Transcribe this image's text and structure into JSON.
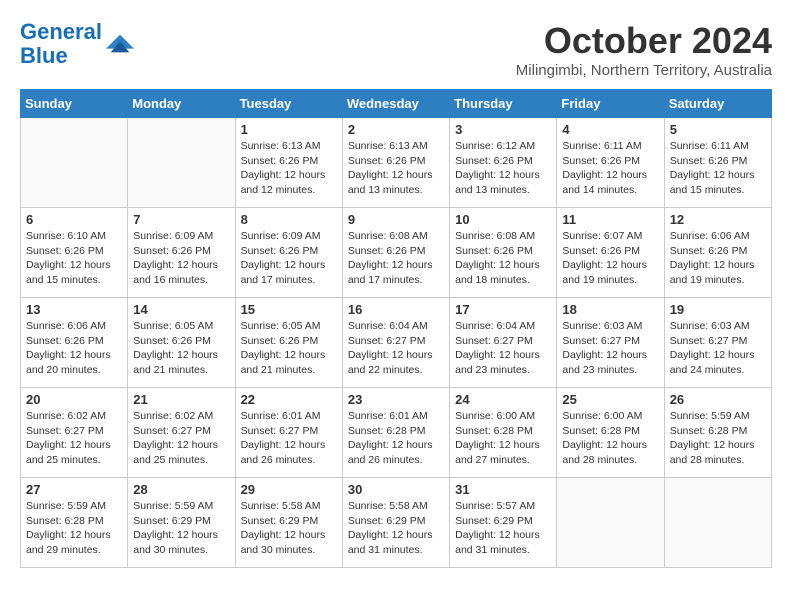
{
  "header": {
    "logo_line1": "General",
    "logo_line2": "Blue",
    "month_year": "October 2024",
    "location": "Milingimbi, Northern Territory, Australia"
  },
  "days_of_week": [
    "Sunday",
    "Monday",
    "Tuesday",
    "Wednesday",
    "Thursday",
    "Friday",
    "Saturday"
  ],
  "weeks": [
    [
      {
        "day": "",
        "sunrise": "",
        "sunset": "",
        "daylight": ""
      },
      {
        "day": "",
        "sunrise": "",
        "sunset": "",
        "daylight": ""
      },
      {
        "day": "1",
        "sunrise": "Sunrise: 6:13 AM",
        "sunset": "Sunset: 6:26 PM",
        "daylight": "Daylight: 12 hours and 12 minutes."
      },
      {
        "day": "2",
        "sunrise": "Sunrise: 6:13 AM",
        "sunset": "Sunset: 6:26 PM",
        "daylight": "Daylight: 12 hours and 13 minutes."
      },
      {
        "day": "3",
        "sunrise": "Sunrise: 6:12 AM",
        "sunset": "Sunset: 6:26 PM",
        "daylight": "Daylight: 12 hours and 13 minutes."
      },
      {
        "day": "4",
        "sunrise": "Sunrise: 6:11 AM",
        "sunset": "Sunset: 6:26 PM",
        "daylight": "Daylight: 12 hours and 14 minutes."
      },
      {
        "day": "5",
        "sunrise": "Sunrise: 6:11 AM",
        "sunset": "Sunset: 6:26 PM",
        "daylight": "Daylight: 12 hours and 15 minutes."
      }
    ],
    [
      {
        "day": "6",
        "sunrise": "Sunrise: 6:10 AM",
        "sunset": "Sunset: 6:26 PM",
        "daylight": "Daylight: 12 hours and 15 minutes."
      },
      {
        "day": "7",
        "sunrise": "Sunrise: 6:09 AM",
        "sunset": "Sunset: 6:26 PM",
        "daylight": "Daylight: 12 hours and 16 minutes."
      },
      {
        "day": "8",
        "sunrise": "Sunrise: 6:09 AM",
        "sunset": "Sunset: 6:26 PM",
        "daylight": "Daylight: 12 hours and 17 minutes."
      },
      {
        "day": "9",
        "sunrise": "Sunrise: 6:08 AM",
        "sunset": "Sunset: 6:26 PM",
        "daylight": "Daylight: 12 hours and 17 minutes."
      },
      {
        "day": "10",
        "sunrise": "Sunrise: 6:08 AM",
        "sunset": "Sunset: 6:26 PM",
        "daylight": "Daylight: 12 hours and 18 minutes."
      },
      {
        "day": "11",
        "sunrise": "Sunrise: 6:07 AM",
        "sunset": "Sunset: 6:26 PM",
        "daylight": "Daylight: 12 hours and 19 minutes."
      },
      {
        "day": "12",
        "sunrise": "Sunrise: 6:06 AM",
        "sunset": "Sunset: 6:26 PM",
        "daylight": "Daylight: 12 hours and 19 minutes."
      }
    ],
    [
      {
        "day": "13",
        "sunrise": "Sunrise: 6:06 AM",
        "sunset": "Sunset: 6:26 PM",
        "daylight": "Daylight: 12 hours and 20 minutes."
      },
      {
        "day": "14",
        "sunrise": "Sunrise: 6:05 AM",
        "sunset": "Sunset: 6:26 PM",
        "daylight": "Daylight: 12 hours and 21 minutes."
      },
      {
        "day": "15",
        "sunrise": "Sunrise: 6:05 AM",
        "sunset": "Sunset: 6:26 PM",
        "daylight": "Daylight: 12 hours and 21 minutes."
      },
      {
        "day": "16",
        "sunrise": "Sunrise: 6:04 AM",
        "sunset": "Sunset: 6:27 PM",
        "daylight": "Daylight: 12 hours and 22 minutes."
      },
      {
        "day": "17",
        "sunrise": "Sunrise: 6:04 AM",
        "sunset": "Sunset: 6:27 PM",
        "daylight": "Daylight: 12 hours and 23 minutes."
      },
      {
        "day": "18",
        "sunrise": "Sunrise: 6:03 AM",
        "sunset": "Sunset: 6:27 PM",
        "daylight": "Daylight: 12 hours and 23 minutes."
      },
      {
        "day": "19",
        "sunrise": "Sunrise: 6:03 AM",
        "sunset": "Sunset: 6:27 PM",
        "daylight": "Daylight: 12 hours and 24 minutes."
      }
    ],
    [
      {
        "day": "20",
        "sunrise": "Sunrise: 6:02 AM",
        "sunset": "Sunset: 6:27 PM",
        "daylight": "Daylight: 12 hours and 25 minutes."
      },
      {
        "day": "21",
        "sunrise": "Sunrise: 6:02 AM",
        "sunset": "Sunset: 6:27 PM",
        "daylight": "Daylight: 12 hours and 25 minutes."
      },
      {
        "day": "22",
        "sunrise": "Sunrise: 6:01 AM",
        "sunset": "Sunset: 6:27 PM",
        "daylight": "Daylight: 12 hours and 26 minutes."
      },
      {
        "day": "23",
        "sunrise": "Sunrise: 6:01 AM",
        "sunset": "Sunset: 6:28 PM",
        "daylight": "Daylight: 12 hours and 26 minutes."
      },
      {
        "day": "24",
        "sunrise": "Sunrise: 6:00 AM",
        "sunset": "Sunset: 6:28 PM",
        "daylight": "Daylight: 12 hours and 27 minutes."
      },
      {
        "day": "25",
        "sunrise": "Sunrise: 6:00 AM",
        "sunset": "Sunset: 6:28 PM",
        "daylight": "Daylight: 12 hours and 28 minutes."
      },
      {
        "day": "26",
        "sunrise": "Sunrise: 5:59 AM",
        "sunset": "Sunset: 6:28 PM",
        "daylight": "Daylight: 12 hours and 28 minutes."
      }
    ],
    [
      {
        "day": "27",
        "sunrise": "Sunrise: 5:59 AM",
        "sunset": "Sunset: 6:28 PM",
        "daylight": "Daylight: 12 hours and 29 minutes."
      },
      {
        "day": "28",
        "sunrise": "Sunrise: 5:59 AM",
        "sunset": "Sunset: 6:29 PM",
        "daylight": "Daylight: 12 hours and 30 minutes."
      },
      {
        "day": "29",
        "sunrise": "Sunrise: 5:58 AM",
        "sunset": "Sunset: 6:29 PM",
        "daylight": "Daylight: 12 hours and 30 minutes."
      },
      {
        "day": "30",
        "sunrise": "Sunrise: 5:58 AM",
        "sunset": "Sunset: 6:29 PM",
        "daylight": "Daylight: 12 hours and 31 minutes."
      },
      {
        "day": "31",
        "sunrise": "Sunrise: 5:57 AM",
        "sunset": "Sunset: 6:29 PM",
        "daylight": "Daylight: 12 hours and 31 minutes."
      },
      {
        "day": "",
        "sunrise": "",
        "sunset": "",
        "daylight": ""
      },
      {
        "day": "",
        "sunrise": "",
        "sunset": "",
        "daylight": ""
      }
    ]
  ]
}
